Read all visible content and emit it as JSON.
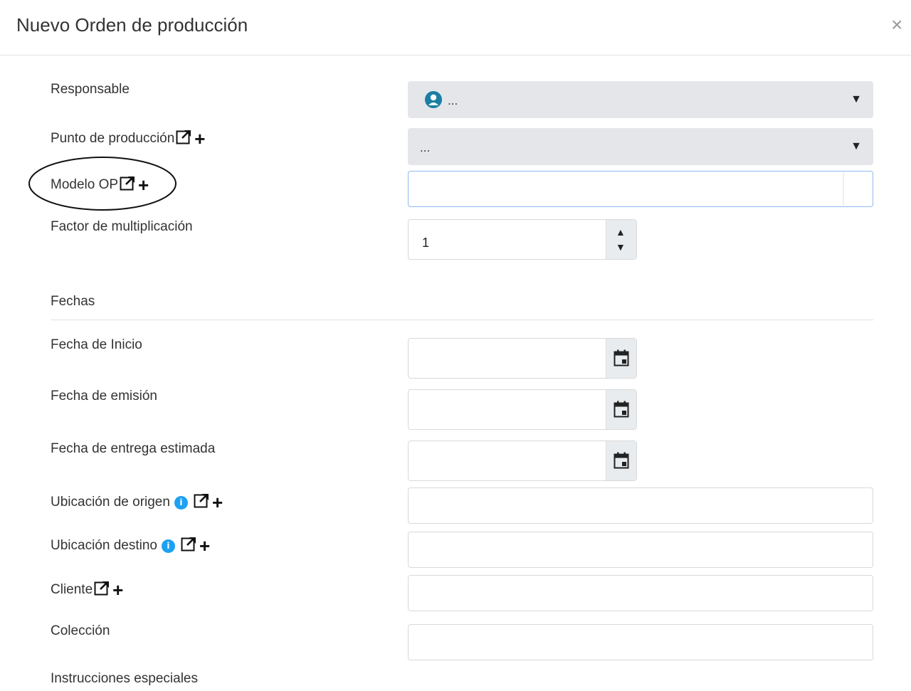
{
  "dialog": {
    "title": "Nuevo Orden de producción",
    "close_symbol": "×"
  },
  "fields": {
    "responsable": {
      "label": "Responsable",
      "value": "..."
    },
    "punto_produccion": {
      "label": "Punto de producción",
      "value": "..."
    },
    "modelo_op": {
      "label": "Modelo OP",
      "value": ""
    },
    "factor": {
      "label": "Factor de multiplicación",
      "value": "1"
    },
    "fechas_section": {
      "label": "Fechas"
    },
    "fecha_inicio": {
      "label": "Fecha de Inicio",
      "value": ""
    },
    "fecha_emision": {
      "label": "Fecha de emisión",
      "value": ""
    },
    "fecha_entrega": {
      "label": "Fecha de entrega estimada",
      "value": ""
    },
    "ubicacion_origen": {
      "label": "Ubicación de origen",
      "value": ""
    },
    "ubicacion_destino": {
      "label": "Ubicación destino",
      "value": ""
    },
    "cliente": {
      "label": "Cliente",
      "value": ""
    },
    "coleccion": {
      "label": "Colección",
      "value": ""
    },
    "instrucciones": {
      "label": "Instrucciones especiales"
    }
  },
  "icons": {
    "caret": "▼",
    "spin_up": "▲",
    "spin_down": "▼",
    "plus": "+",
    "info": "i",
    "info_color": "#1da1f2",
    "user_icon_color": "#1a7fa3",
    "focus_border": "#8fbaf0"
  }
}
